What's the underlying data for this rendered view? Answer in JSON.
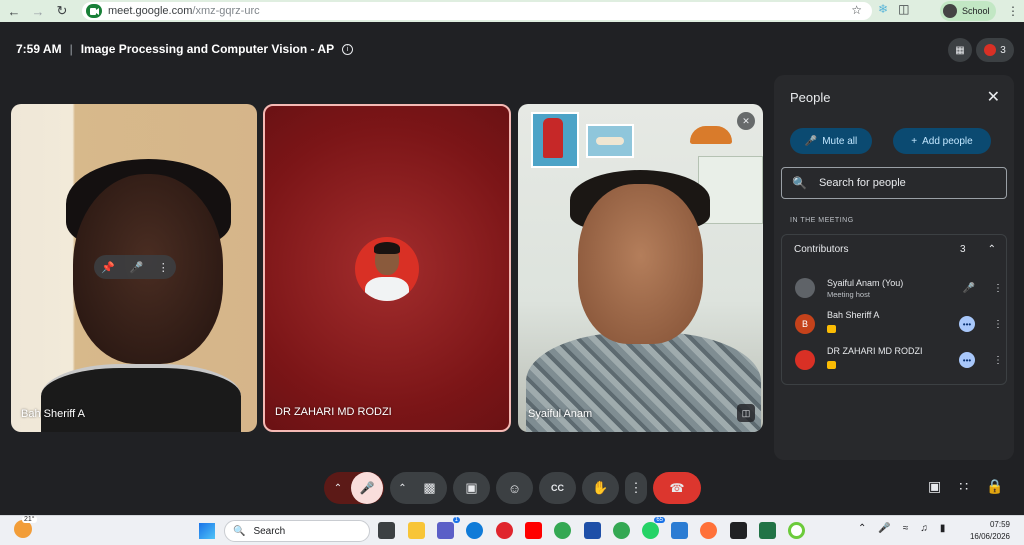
{
  "browser": {
    "url_domain": "meet.google.com",
    "url_path": "/xmz-gqrz-urc",
    "profile_label": "School"
  },
  "meeting": {
    "time": "7:59 AM",
    "separator": "|",
    "title": "Image Processing and Computer Vision - AP",
    "participant_count": "3"
  },
  "tiles": [
    {
      "name": "Bah Sheriff A"
    },
    {
      "name": "DR ZAHARI MD RODZI"
    },
    {
      "name": "Syaiful Anam"
    }
  ],
  "people_panel": {
    "title": "People",
    "mute_all_label": "Mute all",
    "add_people_label": "Add people",
    "search_placeholder": "Search for people",
    "section_label": "IN THE MEETING",
    "group_label": "Contributors",
    "group_count": "3",
    "participants": [
      {
        "name": "Syaiful Anam (You)",
        "subtitle": "Meeting host",
        "initial": ""
      },
      {
        "name": "Bah Sheriff A",
        "subtitle": "",
        "initial": "B"
      },
      {
        "name": "DR ZAHARI MD RODZI",
        "subtitle": "",
        "initial": ""
      }
    ]
  },
  "taskbar": {
    "weather_temp": "21°",
    "search_label": "Search",
    "teams_badge": "1",
    "whatsapp_badge": "65",
    "time": "07:59",
    "date": "16/06/2026"
  },
  "colors": {
    "end_call": "#dc362e",
    "accent_button": "#0b4a71",
    "raised_hand": "#fbbc04"
  }
}
